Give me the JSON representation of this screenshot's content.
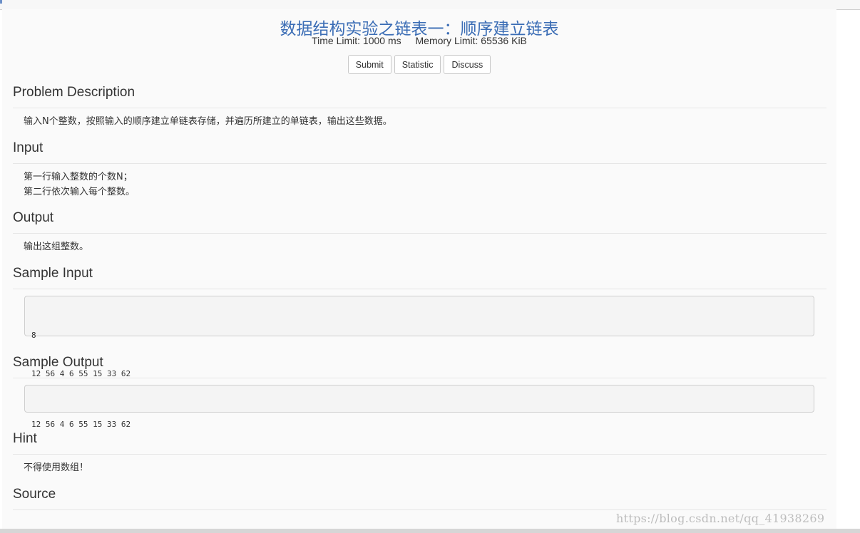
{
  "problem": {
    "title": "数据结构实验之链表一：顺序建立链表",
    "time_limit": "Time Limit: 1000 ms",
    "memory_limit": "Memory Limit: 65536 KiB"
  },
  "buttons": {
    "submit": "Submit",
    "statistic": "Statistic",
    "discuss": "Discuss"
  },
  "sections": {
    "description": {
      "title": "Problem Description",
      "text": "输入N个整数，按照输入的顺序建立单链表存储，并遍历所建立的单链表，输出这些数据。"
    },
    "input": {
      "title": "Input",
      "line1": "第一行输入整数的个数N；",
      "line2": "第二行依次输入每个整数。"
    },
    "output": {
      "title": "Output",
      "text": "输出这组整数。"
    },
    "sample_input": {
      "title": "Sample Input",
      "line1": "8",
      "line2": "12 56 4 6 55 15 33 62"
    },
    "sample_output": {
      "title": "Sample Output",
      "line1": "12 56 4 6 55 15 33 62"
    },
    "hint": {
      "title": "Hint",
      "text": "不得使用数组！"
    },
    "source": {
      "title": "Source",
      "text": ""
    }
  },
  "watermark": "https://blog.csdn.net/qq_41938269"
}
